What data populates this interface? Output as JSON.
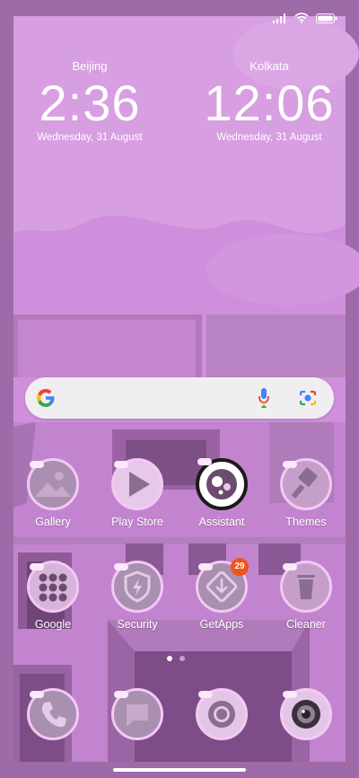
{
  "clocks": [
    {
      "city": "Beijing",
      "time": "2:36",
      "date": "Wednesday, 31 August"
    },
    {
      "city": "Kolkata",
      "time": "12:06",
      "date": "Wednesday, 31 August"
    }
  ],
  "status_bar": {
    "icons": [
      "signal-icon",
      "wifi-icon",
      "battery-icon"
    ]
  },
  "search_bar": {
    "icons": [
      "google-logo-icon",
      "microphone-icon",
      "lens-camera-icon"
    ]
  },
  "apps_row1": [
    {
      "label": "Gallery"
    },
    {
      "label": "Play Store"
    },
    {
      "label": "Assistant"
    },
    {
      "label": "Themes"
    }
  ],
  "apps_row2": [
    {
      "label": "Google"
    },
    {
      "label": "Security"
    },
    {
      "label": "GetApps",
      "badge": "29"
    },
    {
      "label": "Cleaner"
    }
  ],
  "dock": [
    {
      "icon": "phone-icon"
    },
    {
      "icon": "messages-icon"
    },
    {
      "icon": "browser-icon"
    },
    {
      "icon": "camera-icon"
    }
  ],
  "page_indicator": {
    "pages": 2,
    "active": 1
  },
  "colors": {
    "wallpaper": "#c98ad6",
    "frame": "#9b67a5",
    "badge": "#f0531c"
  }
}
